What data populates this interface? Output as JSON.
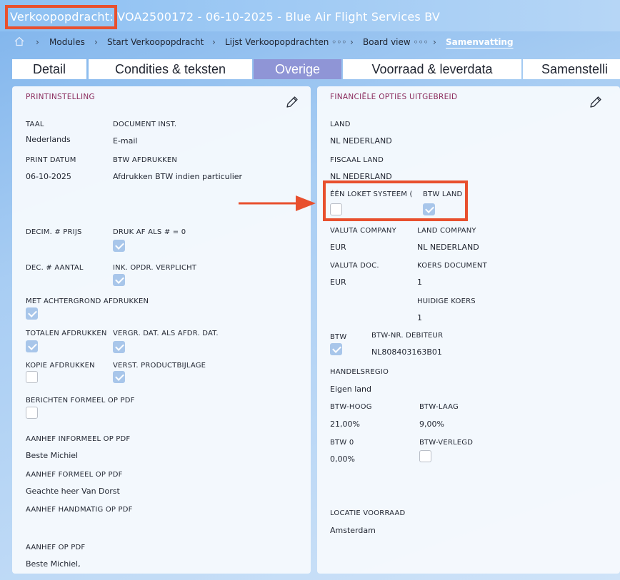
{
  "header": {
    "title": "Verkoopopdracht: VOA2500172 - 06-10-2025 - Blue Air Flight Services BV"
  },
  "breadcrumb": {
    "items": [
      "Modules",
      "Start Verkoopopdracht",
      "Lijst Verkoopopdrachten ◦◦◦",
      "Board view ◦◦◦",
      "Samenvatting"
    ]
  },
  "tabs": [
    "Detail",
    "Condities & teksten",
    "Overige",
    "Voorraad & leverdata",
    "Samenstelli"
  ],
  "left": {
    "title": "PRINTINSTELLING",
    "taal_label": "TAAL",
    "taal_value": "Nederlands",
    "docinst_label": "DOCUMENT INST.",
    "docinst_value": "E-mail",
    "printdatum_label": "PRINT DATUM",
    "printdatum_value": "06-10-2025",
    "btwafdr_label": "BTW AFDRUKKEN",
    "btwafdr_value": "Afdrukken BTW indien particulier",
    "decprijs_label": "DECIM. # PRIJS",
    "drukaf_label": "DRUK AF ALS # = 0",
    "decaantal_label": "DEC. # AANTAL",
    "inkopdr_label": "INK. OPDR. VERPLICHT",
    "achtergrond_label": "MET ACHTERGROND AFDRUKKEN",
    "totalen_label": "TOTALEN AFDRUKKEN",
    "vergr_label": "VERGR. DAT. ALS AFDR. DAT.",
    "kopie_label": "KOPIE AFDRUKKEN",
    "verst_label": "VERST. PRODUCTBIJLAGE",
    "berichten_label": "BERICHTEN FORMEEL OP PDF",
    "aanhef_inf_label": "AANHEF INFORMEEL OP PDF",
    "aanhef_inf_value": "Beste Michiel",
    "aanhef_form_label": "AANHEF FORMEEL OP PDF",
    "aanhef_form_value": "Geachte heer Van Dorst",
    "aanhef_hand_label": "AANHEF HANDMATIG OP PDF",
    "aanhef_pdf_label": "AANHEF OP PDF",
    "aanhef_pdf_value": "Beste Michiel,"
  },
  "right": {
    "title": "FINANCIËLE OPTIES UITGEBREID",
    "land_label": "LAND",
    "land_value": "NL NEDERLAND",
    "fiscaal_label": "FISCAAL LAND",
    "fiscaal_value": "NL NEDERLAND",
    "eenloket_label": "ÉÉN LOKET SYSTEEM (",
    "btwland_label": "BTW LAND",
    "valcomp_label": "VALUTA COMPANY",
    "valcomp_value": "EUR",
    "landcomp_label": "LAND COMPANY",
    "landcomp_value": "NL NEDERLAND",
    "valdoc_label": "VALUTA DOC.",
    "valdoc_value": "EUR",
    "koersdoc_label": "KOERS DOCUMENT",
    "koersdoc_value": "1",
    "huidig_label": "HUIDIGE KOERS",
    "huidig_value": "1",
    "btw_label": "BTW",
    "btwnr_label": "BTW-NR. DEBITEUR",
    "btwnr_value": "NL808403163B01",
    "handelsregio_label": "HANDELSREGIO",
    "handelsregio_value": "Eigen land",
    "btwhoog_label": "BTW-HOOG",
    "btwhoog_value": "21,00%",
    "btwlaag_label": "BTW-LAAG",
    "btwlaag_value": "9,00%",
    "btw0_label": "BTW 0",
    "btw0_value": "0,00%",
    "btwverlegd_label": "BTW-VERLEGD",
    "locatie_label": "LOCATIE VOORRAAD",
    "locatie_value": "Amsterdam"
  },
  "colors": {
    "accent": "#e8502e",
    "tab_active": "#8f95d6",
    "panel_title": "#8a2a5c"
  }
}
